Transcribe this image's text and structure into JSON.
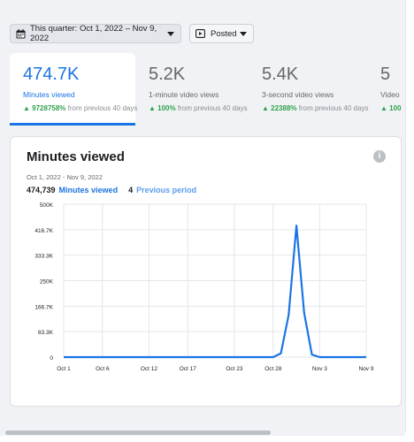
{
  "toolbar": {
    "date_range": "This quarter: Oct 1, 2022 – Nov 9, 2022",
    "filter": "Posted"
  },
  "metrics": [
    {
      "value": "474.7K",
      "label": "Minutes viewed",
      "change": "9728758%",
      "suffix": "from previous 40 days"
    },
    {
      "value": "5.2K",
      "label": "1-minute video views",
      "change": "100%",
      "suffix": "from previous 40 days"
    },
    {
      "value": "5.4K",
      "label": "3-second video views",
      "change": "22388%",
      "suffix": "from previous 40 days"
    },
    {
      "value": "5",
      "label": "Video",
      "change": "100",
      "suffix": ""
    }
  ],
  "card": {
    "title": "Minutes viewed",
    "range": "Oct 1, 2022 - Nov 9, 2022",
    "current_value": "474,739",
    "current_label": "Minutes viewed",
    "previous_value": "4",
    "previous_label": "Previous period"
  },
  "chart_data": {
    "type": "line",
    "title": "Minutes viewed",
    "x_ticks": [
      "Oct 1",
      "Oct 6",
      "Oct 12",
      "Oct 17",
      "Oct 23",
      "Oct 28",
      "Nov 3",
      "Nov 9"
    ],
    "y_ticks": [
      "0",
      "83.3K",
      "166.7K",
      "250K",
      "333.3K",
      "416.7K",
      "500K"
    ],
    "ylim": [
      0,
      500000
    ],
    "grid": true,
    "color": "#1b74e4",
    "series": [
      {
        "name": "Minutes viewed",
        "points": [
          [
            "Oct 1",
            0
          ],
          [
            "Oct 6",
            0
          ],
          [
            "Oct 12",
            0
          ],
          [
            "Oct 17",
            0
          ],
          [
            "Oct 23",
            0
          ],
          [
            "Oct 28",
            0
          ],
          [
            "Oct 29",
            12000
          ],
          [
            "Oct 30",
            138000
          ],
          [
            "Oct 31",
            430000
          ],
          [
            "Nov 1",
            145000
          ],
          [
            "Nov 2",
            8000
          ],
          [
            "Nov 3",
            0
          ],
          [
            "Nov 6",
            0
          ],
          [
            "Nov 9",
            0
          ]
        ]
      }
    ]
  }
}
